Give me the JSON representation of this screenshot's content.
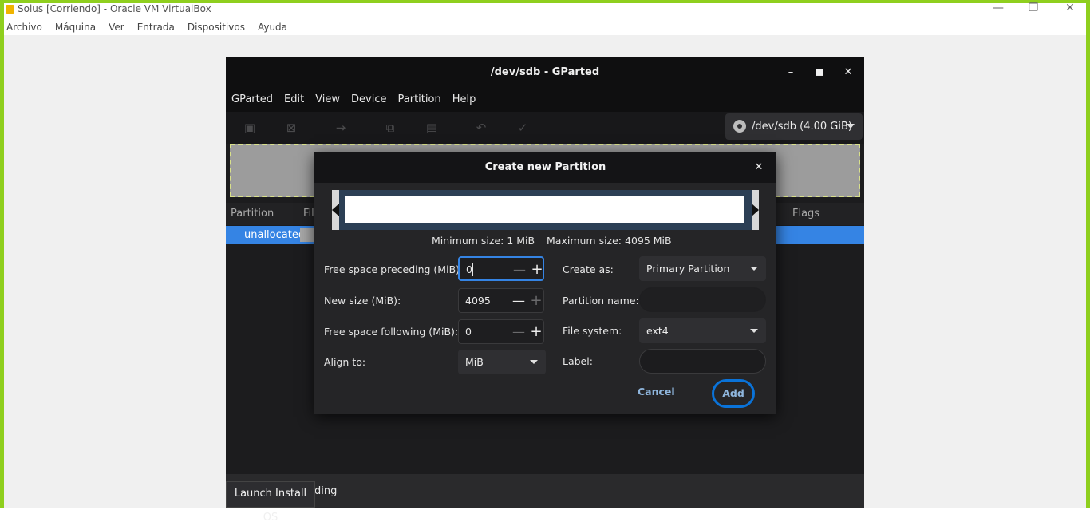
{
  "host": {
    "title": "Solus [Corriendo] - Oracle VM VirtualBox",
    "menu": [
      "Archivo",
      "Máquina",
      "Ver",
      "Entrada",
      "Dispositivos",
      "Ayuda"
    ],
    "accent_color": "#8fcf1e"
  },
  "gparted": {
    "title": "/dev/sdb - GParted",
    "menu": [
      "GParted",
      "Edit",
      "View",
      "Device",
      "Partition",
      "Help"
    ],
    "toolbar_icons": [
      "new-icon",
      "delete-icon",
      "resize-move-icon",
      "copy-icon",
      "paste-icon",
      "undo-icon",
      "apply-icon"
    ],
    "device": "/dev/sdb (4.00 GiB)",
    "columns": {
      "partition": "Partition",
      "filesystem": "Fil",
      "flags": "Flags"
    },
    "row": {
      "partition": "unallocated"
    },
    "status": "ding",
    "tooltip": "Launch Install OS",
    "selection_color": "#3584e4"
  },
  "dialog": {
    "title": "Create new Partition",
    "min_size": "Minimum size: 1 MiB",
    "max_size": "Maximum size: 4095 MiB",
    "fields": {
      "free_preceding": {
        "label": "Free space preceding (MiB):",
        "value": "0"
      },
      "new_size": {
        "label": "New size (MiB):",
        "value": "4095"
      },
      "free_following": {
        "label": "Free space following (MiB):",
        "value": "0"
      },
      "align_to": {
        "label": "Align to:",
        "value": "MiB"
      },
      "create_as": {
        "label": "Create as:",
        "value": "Primary Partition"
      },
      "partition_name": {
        "label": "Partition name:",
        "value": ""
      },
      "file_system": {
        "label": "File system:",
        "value": "ext4"
      },
      "fs_label": {
        "label": "Label:",
        "value": ""
      }
    },
    "cancel": "Cancel",
    "add": "Add",
    "annotation_color": "#0a73d9"
  }
}
